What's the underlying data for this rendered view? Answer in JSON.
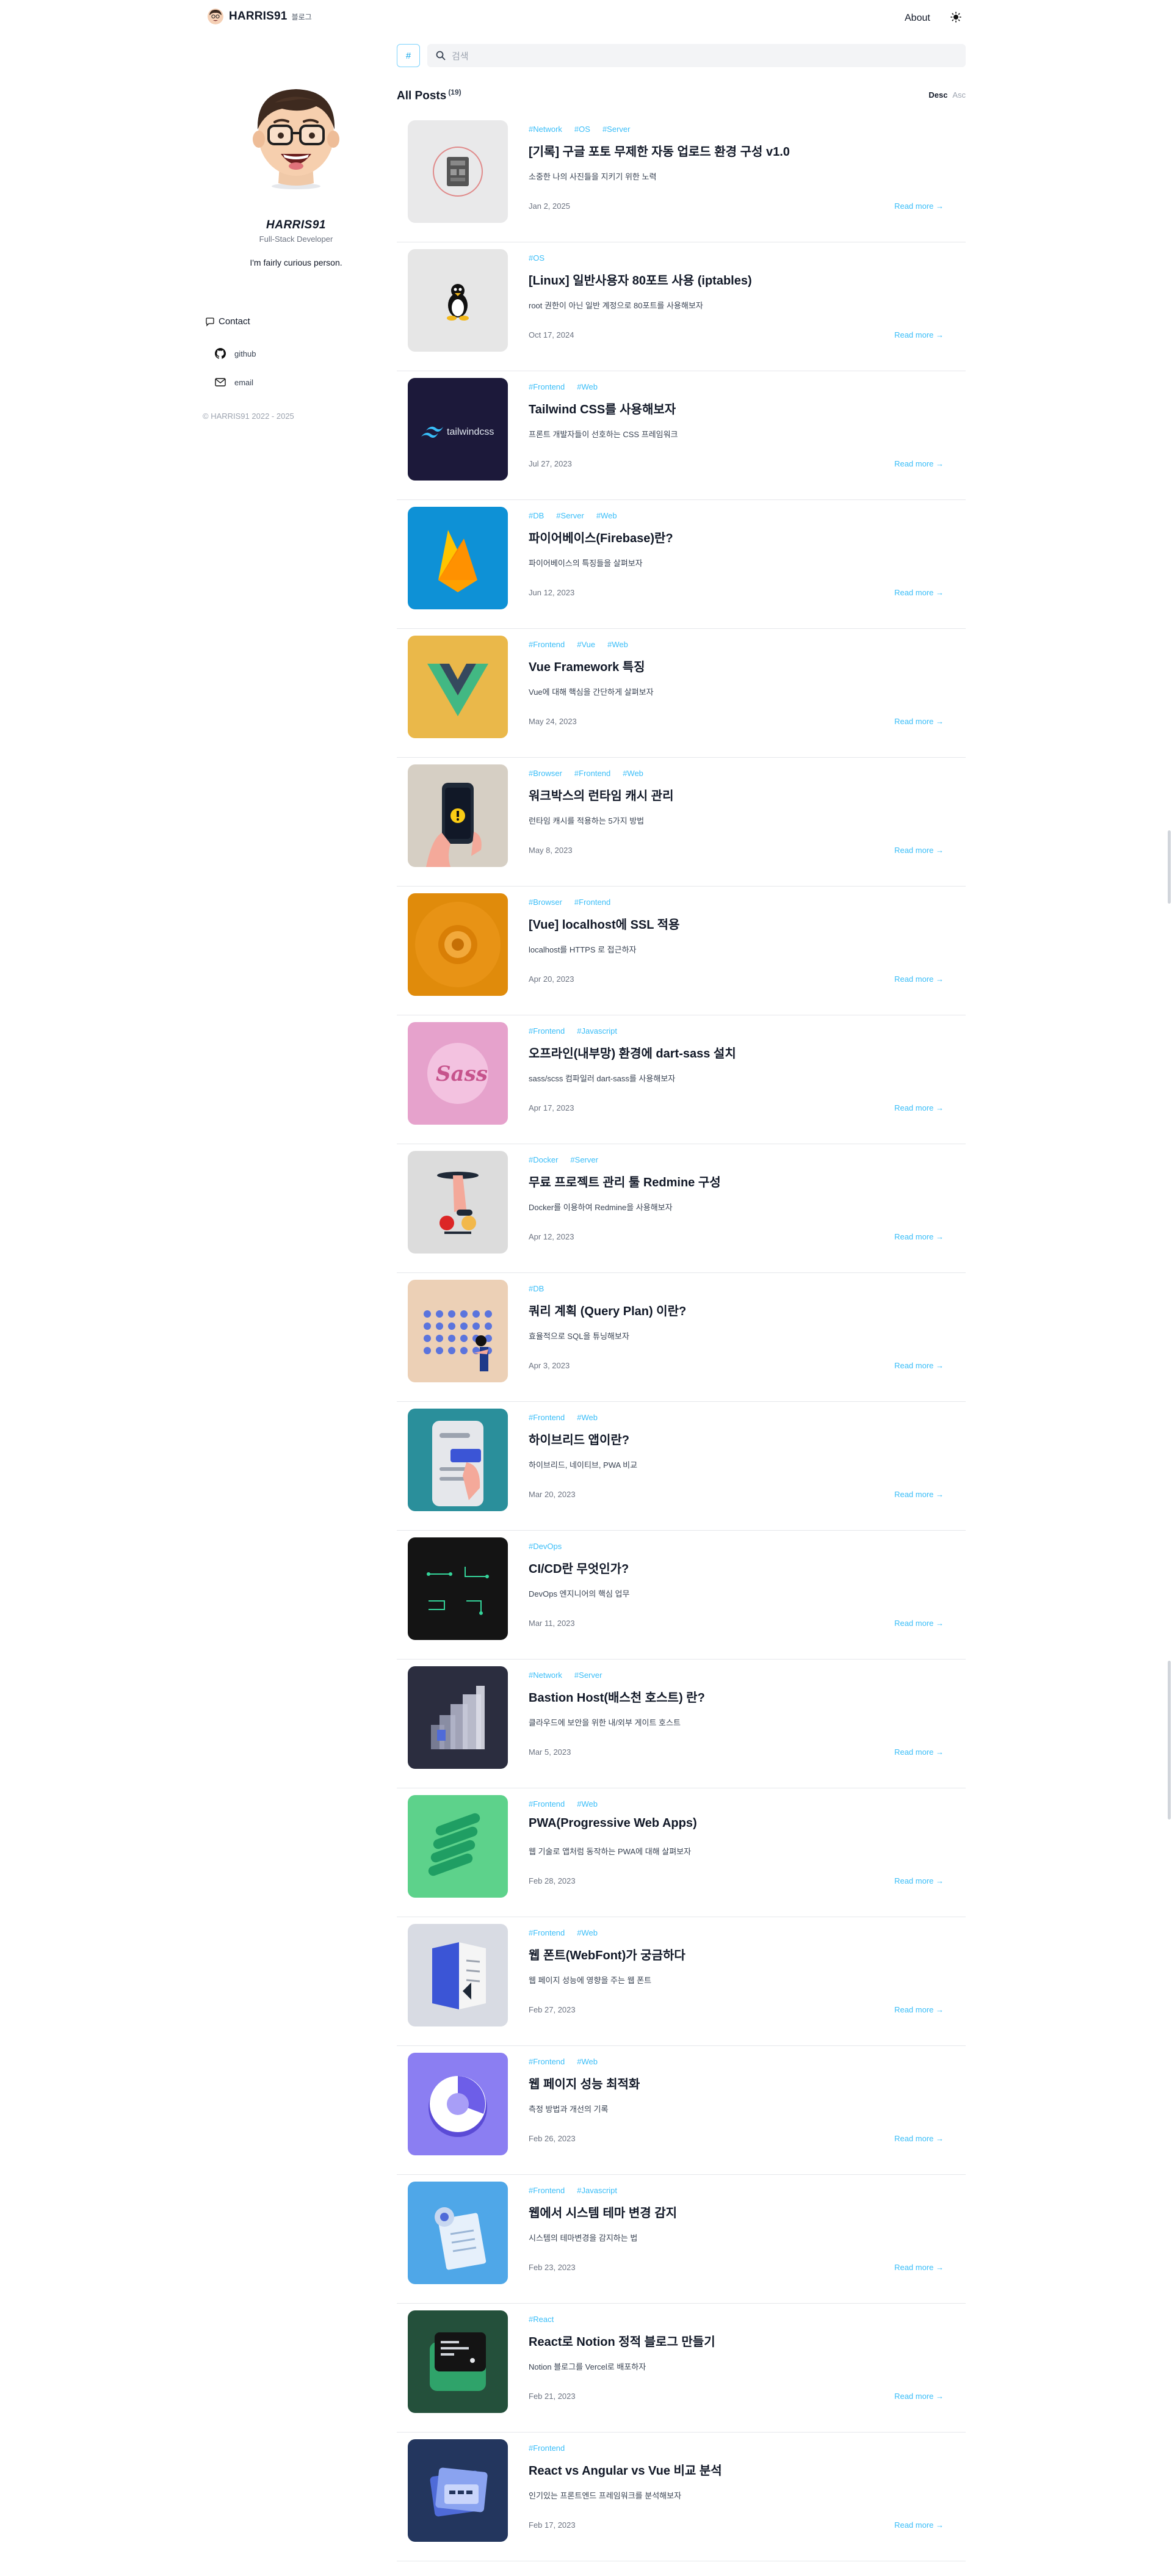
{
  "brand": {
    "name": "HARRIS91",
    "sub": "블로그"
  },
  "nav": {
    "about": "About"
  },
  "profile": {
    "name": "HARRIS91",
    "role": "Full-Stack Developer",
    "bio": "I'm fairly curious person.",
    "contact_title": "Contact",
    "links": [
      {
        "label": "github",
        "icon": "github-icon"
      },
      {
        "label": "email",
        "icon": "mail-icon"
      }
    ],
    "copyright": "© HARRIS91 2022 - 2025"
  },
  "search": {
    "hash_label": "#",
    "placeholder": "검색"
  },
  "posts_header": {
    "title": "All Posts",
    "count": "(19)",
    "sort_desc": "Desc",
    "sort_asc": "Asc"
  },
  "read_more": "Read more →",
  "posts": [
    {
      "tags": [
        "#Network",
        "#OS",
        "#Server"
      ],
      "title": "[기록] 구글 포토 무제한 자동 업로드 환경 구성 v1.0",
      "desc": "소중한 나의 사진들을 지키기 위한 노력",
      "date": "Jan 2, 2025",
      "thumb": "board"
    },
    {
      "tags": [
        "#OS"
      ],
      "title": "[Linux] 일반사용자 80포트 사용 (iptables)",
      "desc": "root 권한이 아닌 일반 계정으로 80포트를 사용해보자",
      "date": "Oct 17, 2024",
      "thumb": "linux"
    },
    {
      "tags": [
        "#Frontend",
        "#Web"
      ],
      "title": "Tailwind CSS를 사용해보자",
      "desc": "프론트 개발자들이 선호하는 CSS 프레임워크",
      "date": "Jul 27, 2023",
      "thumb": "tailwind"
    },
    {
      "tags": [
        "#DB",
        "#Server",
        "#Web"
      ],
      "title": "파이어베이스(Firebase)란?",
      "desc": "파이어베이스의 특징들을 살펴보자",
      "date": "Jun 12, 2023",
      "thumb": "firebase"
    },
    {
      "tags": [
        "#Frontend",
        "#Vue",
        "#Web"
      ],
      "title": "Vue Framework 특징",
      "desc": "Vue에 대해 핵심을 간단하게 살펴보자",
      "date": "May 24, 2023",
      "thumb": "vue"
    },
    {
      "tags": [
        "#Browser",
        "#Frontend",
        "#Web"
      ],
      "title": "워크박스의 런타임 캐시 관리",
      "desc": "런타임 캐시를 적용하는 5가지 방법",
      "date": "May 8, 2023",
      "thumb": "phone"
    },
    {
      "tags": [
        "#Browser",
        "#Frontend"
      ],
      "title": "[Vue] localhost에 SSL 적용",
      "desc": "localhost를 HTTPS 로 접근하자",
      "date": "Apr 20, 2023",
      "thumb": "lock"
    },
    {
      "tags": [
        "#Frontend",
        "#Javascript"
      ],
      "title": "오프라인(내부망) 환경에 dart-sass 설치",
      "desc": "sass/scss 컴파일러 dart-sass를 사용해보자",
      "date": "Apr 17, 2023",
      "thumb": "sass"
    },
    {
      "tags": [
        "#Docker",
        "#Server"
      ],
      "title": "무료 프로젝트 관리 툴 Redmine 구성",
      "desc": "Docker를 이용하여 Redmine을 사용해보자",
      "date": "Apr 12, 2023",
      "thumb": "redmine"
    },
    {
      "tags": [
        "#DB"
      ],
      "title": "쿼리 계획 (Query Plan) 이란?",
      "desc": "효율적으로 SQL을 튜닝해보자",
      "date": "Apr 3, 2023",
      "thumb": "query"
    },
    {
      "tags": [
        "#Frontend",
        "#Web"
      ],
      "title": "하이브리드 앱이란?",
      "desc": "하이브리드, 네이티브, PWA 비교",
      "date": "Mar 20, 2023",
      "thumb": "hybrid"
    },
    {
      "tags": [
        "#DevOps"
      ],
      "title": "CI/CD란 무엇인가?",
      "desc": "DevOps 엔지니어의 핵심 업무",
      "date": "Mar 11, 2023",
      "thumb": "cicd"
    },
    {
      "tags": [
        "#Network",
        "#Server"
      ],
      "title": "Bastion Host(배스천 호스트) 란?",
      "desc": "클라우드에 보안을 위한 내/외부 게이트 호스트",
      "date": "Mar 5, 2023",
      "thumb": "bastion"
    },
    {
      "tags": [
        "#Frontend",
        "#Web"
      ],
      "title": "PWA(Progressive Web Apps)",
      "desc": "웹 기술로 앱처럼 동작하는 PWA에 대해 살펴보자",
      "date": "Feb 28, 2023",
      "thumb": "pwa"
    },
    {
      "tags": [
        "#Frontend",
        "#Web"
      ],
      "title": "웹 폰트(WebFont)가 궁금하다",
      "desc": "웹 페이지 성능에 영향을 주는 웹 폰트",
      "date": "Feb 27, 2023",
      "thumb": "webfont"
    },
    {
      "tags": [
        "#Frontend",
        "#Web"
      ],
      "title": "웹 페이지 성능 최적화",
      "desc": "측정 방법과 개선의 기록",
      "date": "Feb 26, 2023",
      "thumb": "perf"
    },
    {
      "tags": [
        "#Frontend",
        "#Javascript"
      ],
      "title": "웹에서 시스템 테마 변경 감지",
      "desc": "시스템의 테마변경을 감지하는 법",
      "date": "Feb 23, 2023",
      "thumb": "theme"
    },
    {
      "tags": [
        "#React"
      ],
      "title": "React로 Notion 정적 블로그 만들기",
      "desc": "Notion 블로그를 Vercel로 배포하자",
      "date": "Feb 21, 2023",
      "thumb": "notion"
    },
    {
      "tags": [
        "#Frontend"
      ],
      "title": "React vs Angular vs Vue 비교 분석",
      "desc": "인기있는 프론트엔드 프레임워크를 분석해보자",
      "date": "Feb 17, 2023",
      "thumb": "folders"
    }
  ],
  "colors": {
    "accent": "#38bdf8",
    "text": "#111827",
    "muted": "#6b7280"
  }
}
